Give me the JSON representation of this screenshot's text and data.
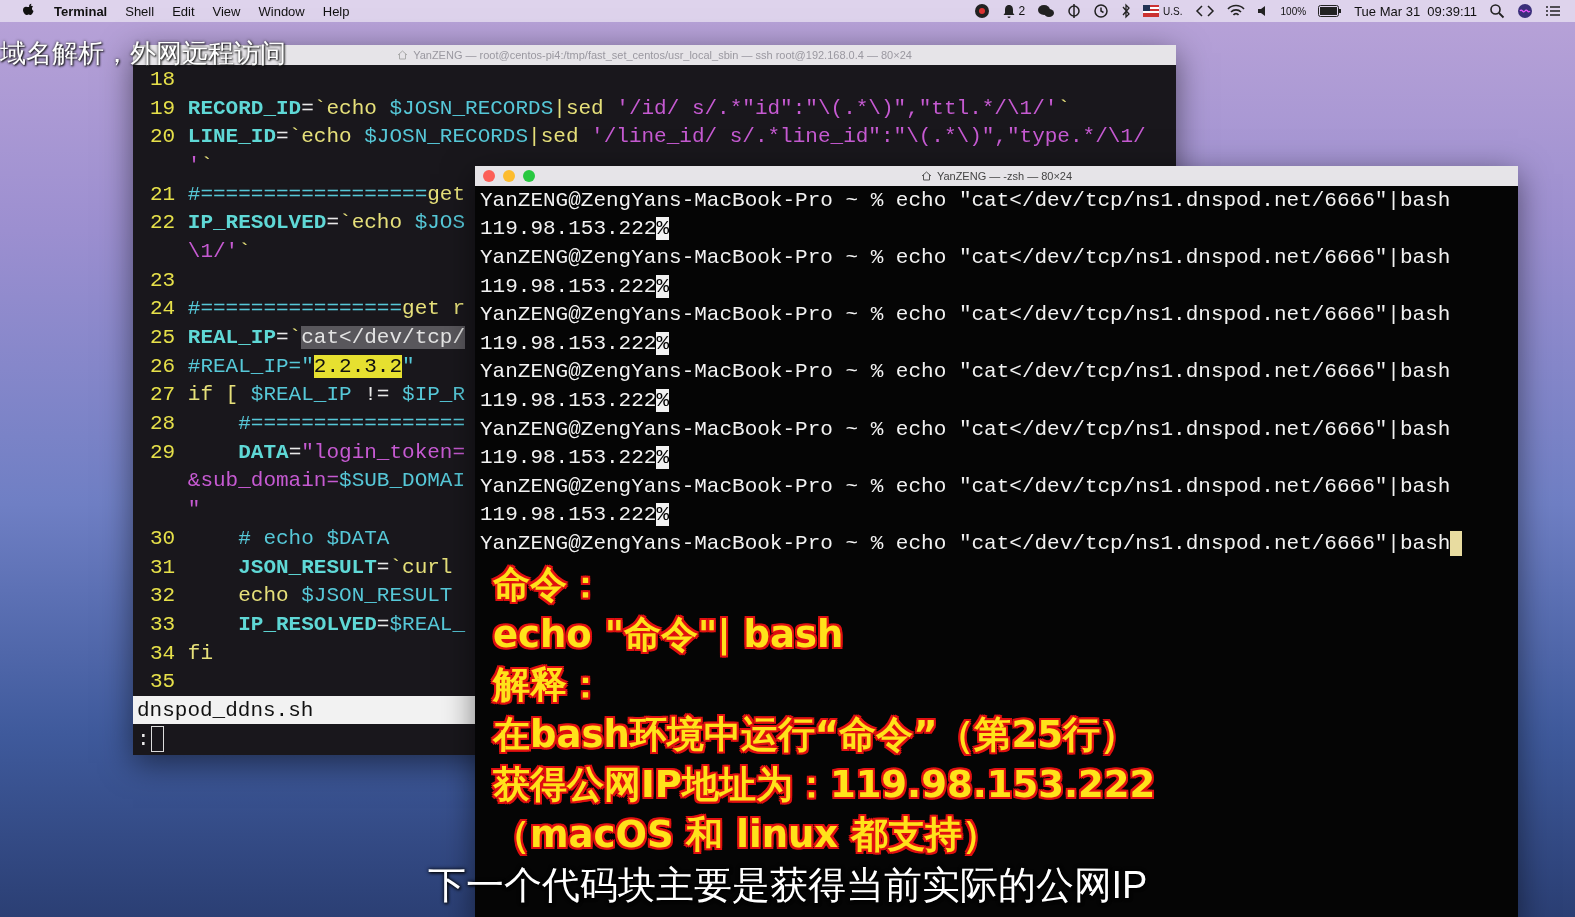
{
  "menu_bar": {
    "app_name": "Terminal",
    "menus": [
      "Shell",
      "Edit",
      "View",
      "Window",
      "Help"
    ],
    "notification_count": "2",
    "input_source": "U.S.",
    "battery": "100%",
    "clock": "Tue Mar 31  09:39:11"
  },
  "video_title": "域名解析，外网远程访问",
  "editor_window": {
    "title": "YanZENG — root@centos-pi4:/tmp/fast_set_centos/usr_local_sbin — ssh root@192.168.0.4 — 80×24",
    "rows": [
      {
        "number": "18",
        "segments": []
      },
      {
        "number": "19",
        "indented": false,
        "segments": [
          {
            "kind": "name",
            "text": "RECORD_ID"
          },
          {
            "kind": "op",
            "text": "="
          },
          {
            "kind": "cmd",
            "text": "`echo "
          },
          {
            "kind": "var",
            "text": "$JOSN_RECORDS"
          },
          {
            "kind": "cmd",
            "text": "|sed "
          },
          {
            "kind": "str",
            "text": "'/id/ s/.*\"id\":\"\\(.*\\)\",\"ttl.*/\\1/'"
          },
          {
            "kind": "cmd",
            "text": "`"
          }
        ]
      },
      {
        "number": "20",
        "indented": false,
        "segments": [
          {
            "kind": "name",
            "text": "LINE_ID"
          },
          {
            "kind": "op",
            "text": "="
          },
          {
            "kind": "cmd",
            "text": "`echo "
          },
          {
            "kind": "var",
            "text": "$JOSN_RECORDS"
          },
          {
            "kind": "cmd",
            "text": "|sed "
          },
          {
            "kind": "str",
            "text": "'/line_id/ s/.*line_id\":\"\\(.*\\)\",\"type.*/\\1/"
          }
        ]
      },
      {
        "indented": false,
        "segments": [
          {
            "kind": "str",
            "text": "'"
          },
          {
            "kind": "cmd",
            "text": "`"
          }
        ]
      },
      {
        "number": "21",
        "indented": false,
        "segments": [
          {
            "kind": "comment",
            "text": "#=================="
          },
          {
            "kind": "cmd",
            "text": "get"
          }
        ]
      },
      {
        "number": "22",
        "indented": false,
        "segments": [
          {
            "kind": "name",
            "text": "IP_RESOLVED"
          },
          {
            "kind": "op",
            "text": "="
          },
          {
            "kind": "cmd",
            "text": "`echo "
          },
          {
            "kind": "var",
            "text": "$JOS"
          }
        ]
      },
      {
        "indented": false,
        "segments": [
          {
            "kind": "str",
            "text": "\\1/'"
          },
          {
            "kind": "cmd",
            "text": "`"
          }
        ]
      },
      {
        "number": "23",
        "segments": []
      },
      {
        "number": "24",
        "indented": false,
        "segments": [
          {
            "kind": "comment",
            "text": "#================"
          },
          {
            "kind": "cmd",
            "text": "get r"
          }
        ]
      },
      {
        "number": "25",
        "indented": false,
        "segments": [
          {
            "kind": "name",
            "text": "REAL_IP"
          },
          {
            "kind": "op",
            "text": "="
          },
          {
            "kind": "cmd",
            "text": "`"
          },
          {
            "kind": "select",
            "text": "cat</dev/tcp/"
          }
        ]
      },
      {
        "number": "26",
        "indented": false,
        "segments": [
          {
            "kind": "comment",
            "text": "#REAL_IP=\""
          },
          {
            "kind": "highlight",
            "text": "2.2.3.2"
          },
          {
            "kind": "comment",
            "text": "\""
          }
        ]
      },
      {
        "number": "27",
        "indented": false,
        "segments": [
          {
            "kind": "cmd",
            "text": "if [ "
          },
          {
            "kind": "var",
            "text": "$REAL_IP"
          },
          {
            "kind": "op",
            "text": " != "
          },
          {
            "kind": "var",
            "text": "$IP_R"
          }
        ]
      },
      {
        "number": "28",
        "indented": true,
        "segments": [
          {
            "kind": "comment",
            "text": "#================="
          }
        ]
      },
      {
        "number": "29",
        "indented": true,
        "segments": [
          {
            "kind": "name",
            "text": "DATA"
          },
          {
            "kind": "op",
            "text": "="
          },
          {
            "kind": "str",
            "text": "\"login_token="
          }
        ]
      },
      {
        "indented": false,
        "segments": [
          {
            "kind": "str",
            "text": "&sub_domain="
          },
          {
            "kind": "var",
            "text": "$SUB_DOMAI"
          }
        ]
      },
      {
        "indented": false,
        "segments": [
          {
            "kind": "str",
            "text": "\""
          }
        ]
      },
      {
        "number": "30",
        "indented": true,
        "segments": [
          {
            "kind": "comment",
            "text": "# echo $DATA"
          }
        ]
      },
      {
        "number": "31",
        "indented": true,
        "segments": [
          {
            "kind": "name",
            "text": "JSON_RESULT"
          },
          {
            "kind": "op",
            "text": "="
          },
          {
            "kind": "cmd",
            "text": "`curl"
          }
        ]
      },
      {
        "number": "32",
        "indented": true,
        "segments": [
          {
            "kind": "cmd",
            "text": "echo "
          },
          {
            "kind": "var",
            "text": "$JSON_RESULT"
          }
        ]
      },
      {
        "number": "33",
        "indented": true,
        "segments": [
          {
            "kind": "name",
            "text": "IP_RESOLVED"
          },
          {
            "kind": "op",
            "text": "="
          },
          {
            "kind": "var",
            "text": "$REAL_"
          }
        ]
      },
      {
        "number": "34",
        "indented": false,
        "segments": [
          {
            "kind": "cmd",
            "text": "fi"
          }
        ]
      },
      {
        "number": "35",
        "segments": []
      }
    ],
    "status_file": "dnspod_ddns.sh",
    "command_line": ":"
  },
  "terminal_window": {
    "title": "YanZENG — -zsh — 80×24",
    "lines": [
      {
        "kind": "prompt",
        "text": "YanZENG@ZengYans-MacBook-Pro ~ % echo \"cat</dev/tcp/ns1.dnspod.net/6666\"|bash",
        "cursor": false
      },
      {
        "kind": "output",
        "text": "119.98.153.222",
        "end_mark": "%"
      },
      {
        "kind": "prompt",
        "text": "YanZENG@ZengYans-MacBook-Pro ~ % echo \"cat</dev/tcp/ns1.dnspod.net/6666\"|bash",
        "cursor": false
      },
      {
        "kind": "output",
        "text": "119.98.153.222",
        "end_mark": "%"
      },
      {
        "kind": "prompt",
        "text": "YanZENG@ZengYans-MacBook-Pro ~ % echo \"cat</dev/tcp/ns1.dnspod.net/6666\"|bash",
        "cursor": false
      },
      {
        "kind": "output",
        "text": "119.98.153.222",
        "end_mark": "%"
      },
      {
        "kind": "prompt",
        "text": "YanZENG@ZengYans-MacBook-Pro ~ % echo \"cat</dev/tcp/ns1.dnspod.net/6666\"|bash",
        "cursor": false
      },
      {
        "kind": "output",
        "text": "119.98.153.222",
        "end_mark": "%"
      },
      {
        "kind": "prompt",
        "text": "YanZENG@ZengYans-MacBook-Pro ~ % echo \"cat</dev/tcp/ns1.dnspod.net/6666\"|bash",
        "cursor": false
      },
      {
        "kind": "output",
        "text": "119.98.153.222",
        "end_mark": "%"
      },
      {
        "kind": "prompt",
        "text": "YanZENG@ZengYans-MacBook-Pro ~ % echo \"cat</dev/tcp/ns1.dnspod.net/6666\"|bash",
        "cursor": false
      },
      {
        "kind": "output",
        "text": "119.98.153.222",
        "end_mark": "%"
      },
      {
        "kind": "prompt",
        "text": "YanZENG@ZengYans-MacBook-Pro ~ % echo \"cat</dev/tcp/ns1.dnspod.net/6666\"|bash",
        "cursor": true
      }
    ]
  },
  "captions": [
    "命令：",
    "echo \"命令\"| bash",
    "解释：",
    "在bash环境中运行“命令”（第25行）",
    "获得公网IP地址为：119.98.153.222",
    "（macOS 和 linux 都支持）"
  ],
  "subtitle": "下一个代码块主要是获得当前实际的公网IP"
}
